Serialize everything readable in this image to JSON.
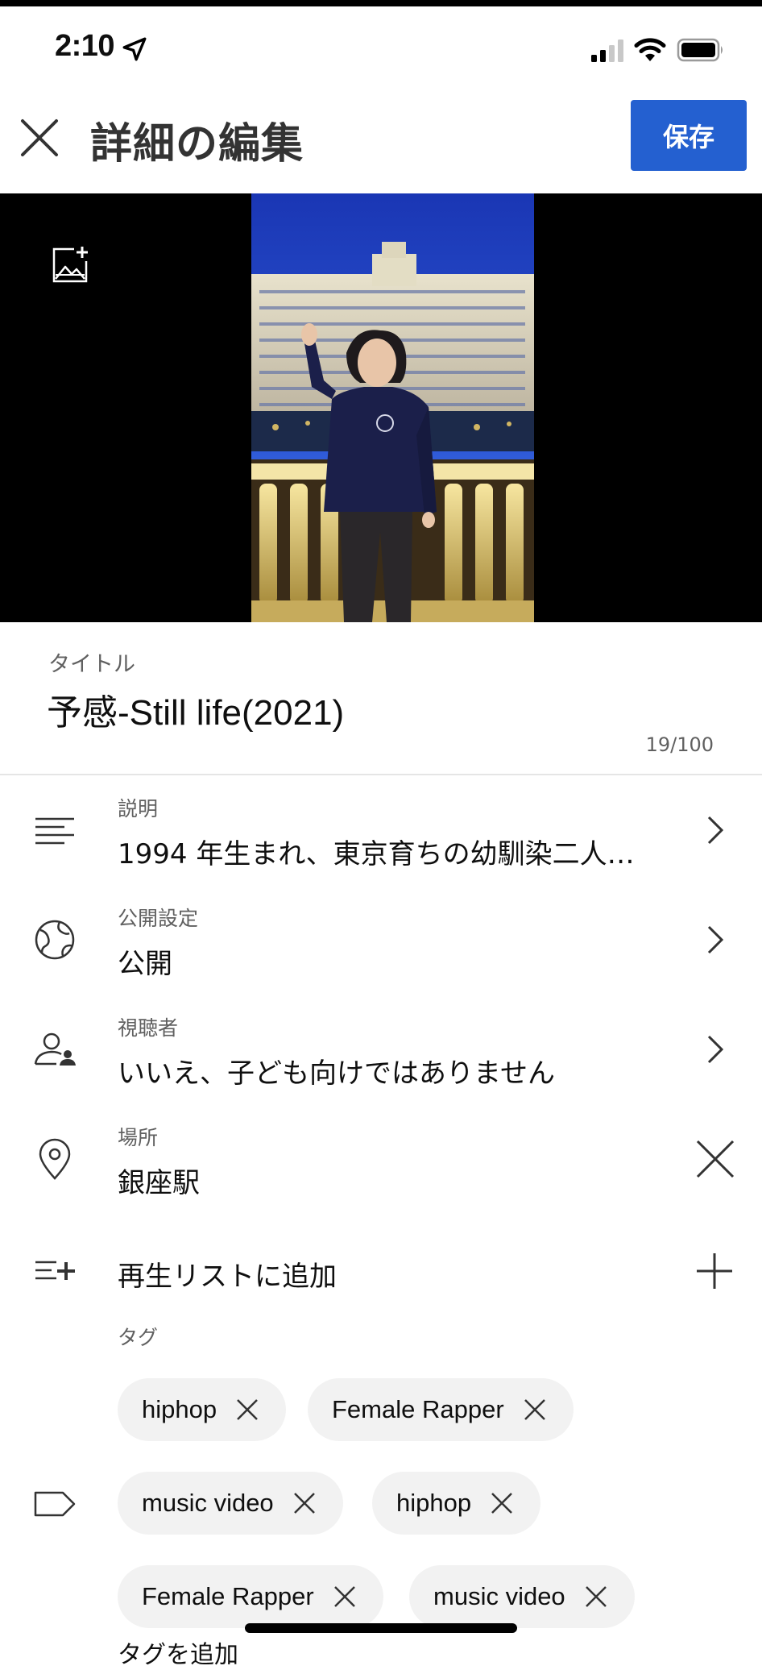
{
  "status_bar": {
    "time": "2:10"
  },
  "header": {
    "title": "詳細の編集",
    "save_label": "保存"
  },
  "title_field": {
    "label": "タイトル",
    "value": "予感-Still life(2021)",
    "counter": "19/100"
  },
  "rows": {
    "description": {
      "label": "説明",
      "value": "1994 年生まれ、東京育ちの幼馴染二人…"
    },
    "visibility": {
      "label": "公開設定",
      "value": "公開"
    },
    "audience": {
      "label": "視聴者",
      "value": "いいえ、子ども向けではありません"
    },
    "location": {
      "label": "場所",
      "value": "銀座駅"
    },
    "playlist": {
      "value": "再生リストに追加"
    }
  },
  "tags": {
    "label": "タグ",
    "items": [
      "hiphop",
      "Female Rapper",
      "music video",
      "hiphop",
      "Female Rapper",
      "music video"
    ]
  },
  "partial_text": "タグを追加",
  "colors": {
    "accent": "#2460d0",
    "chip_bg": "#f2f2f2",
    "secondary_text": "#606060"
  },
  "icons": {
    "close": "close-icon",
    "location_arrow": "location-arrow-icon",
    "signal": "cellular-signal-icon",
    "wifi": "wifi-icon",
    "battery": "battery-icon",
    "thumbnail": "add-image-icon",
    "description": "lines-icon",
    "visibility": "globe-icon",
    "audience": "person-icon",
    "location": "map-pin-icon",
    "location_clear": "close-icon",
    "playlist": "playlist-add-icon",
    "playlist_add": "plus-icon",
    "tags": "tag-icon",
    "chip_remove": "close-icon"
  }
}
